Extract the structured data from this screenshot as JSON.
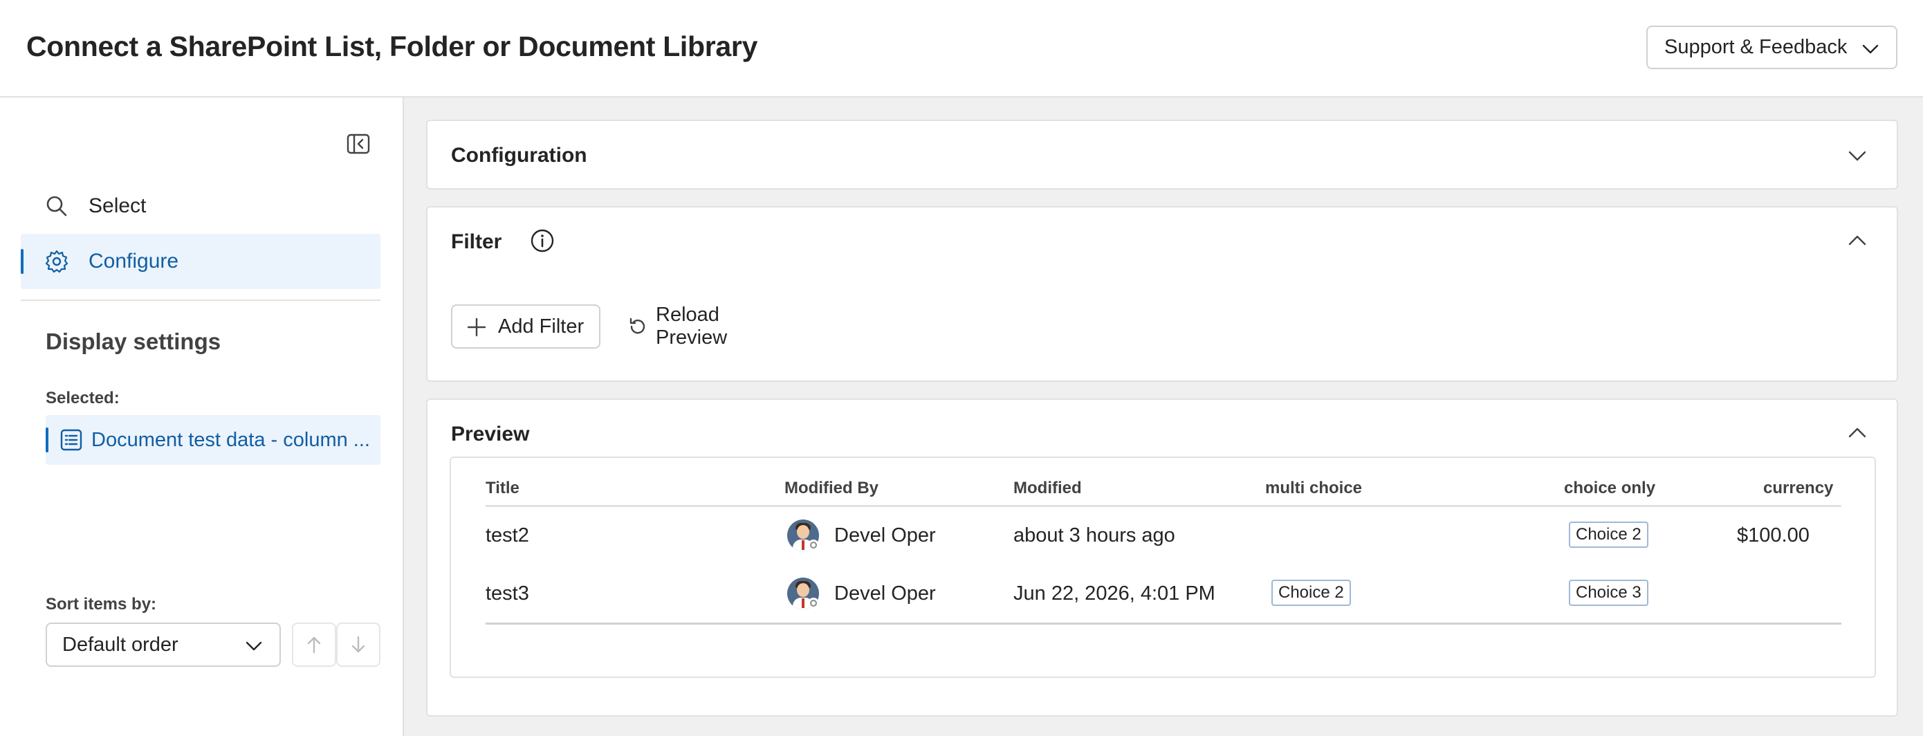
{
  "header": {
    "title": "Connect a SharePoint List, Folder or Document Library",
    "support_label": "Support & Feedback"
  },
  "sidebar": {
    "collapse_icon": "panel-collapse-icon",
    "nav": [
      {
        "label": "Select",
        "icon": "search-icon"
      },
      {
        "label": "Configure",
        "icon": "gear-icon",
        "active": true
      }
    ],
    "display_settings_heading": "Display settings",
    "selected_label": "Selected:",
    "selected_item": "Document test data - column ...",
    "sort_label": "Sort items by:",
    "sort_value": "Default order"
  },
  "main": {
    "configuration": {
      "title": "Configuration",
      "expanded": false
    },
    "filter": {
      "title": "Filter",
      "expanded": true,
      "add_filter_label": "Add Filter",
      "reload_label": "Reload Preview"
    },
    "preview": {
      "title": "Preview",
      "expanded": true,
      "columns": [
        "Title",
        "Modified By",
        "Modified",
        "multi choice",
        "choice only",
        "currency"
      ],
      "rows": [
        {
          "title": "test2",
          "modified_by": "Devel Oper",
          "modified": "about 3 hours ago",
          "multi_choice": "",
          "choice_only": "Choice 2",
          "currency": "$100.00"
        },
        {
          "title": "test3",
          "modified_by": "Devel Oper",
          "modified": "Jun 22, 2026, 4:01 PM",
          "multi_choice": "Choice 2",
          "choice_only": "Choice 3",
          "currency": ""
        }
      ]
    }
  },
  "colors": {
    "accent": "#0f6cbd",
    "accent_text": "#115ea3",
    "selected_bg": "#ebf3fc",
    "main_bg": "#f0f0f0"
  }
}
